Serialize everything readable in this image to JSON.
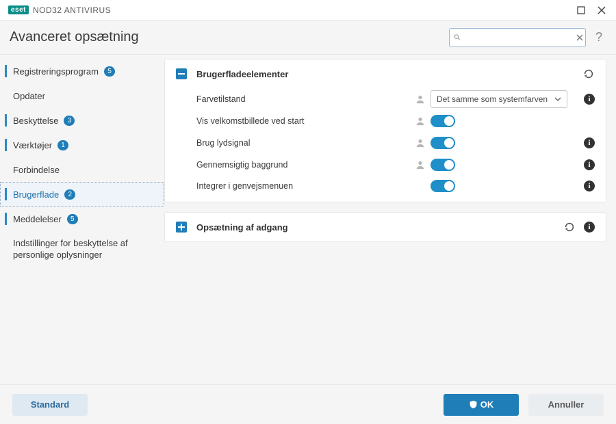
{
  "titlebar": {
    "logo_text": "eset",
    "product": "NOD32 ANTIVIRUS"
  },
  "page_title": "Avanceret opsætning",
  "search": {
    "placeholder": "",
    "value": ""
  },
  "sidebar": {
    "items": [
      {
        "label": "Registreringsprogram",
        "badge": "5",
        "accent": true
      },
      {
        "label": "Opdater",
        "badge": null,
        "accent": false
      },
      {
        "label": "Beskyttelse",
        "badge": "3",
        "accent": true
      },
      {
        "label": "Værktøjer",
        "badge": "1",
        "accent": true
      },
      {
        "label": "Forbindelse",
        "badge": null,
        "accent": false
      },
      {
        "label": "Brugerflade",
        "badge": "2",
        "accent": true,
        "selected": true
      },
      {
        "label": "Meddelelser",
        "badge": "5",
        "accent": true
      },
      {
        "label": "Indstillinger for beskyttelse af personlige oplysninger",
        "badge": null,
        "accent": false
      }
    ]
  },
  "panels": {
    "ui_elements": {
      "title": "Brugerfladeelementer",
      "rows": {
        "color_mode": {
          "label": "Farvetilstand",
          "value": "Det samme som systemfarven"
        },
        "splash": {
          "label": "Vis velkomstbillede ved start"
        },
        "sound": {
          "label": "Brug lydsignal"
        },
        "transparent": {
          "label": "Gennemsigtig baggrund"
        },
        "context": {
          "label": "Integrer i genvejsmenuen"
        }
      }
    },
    "access": {
      "title": "Opsætning af adgang"
    }
  },
  "footer": {
    "default": "Standard",
    "ok": "OK",
    "cancel": "Annuller"
  }
}
